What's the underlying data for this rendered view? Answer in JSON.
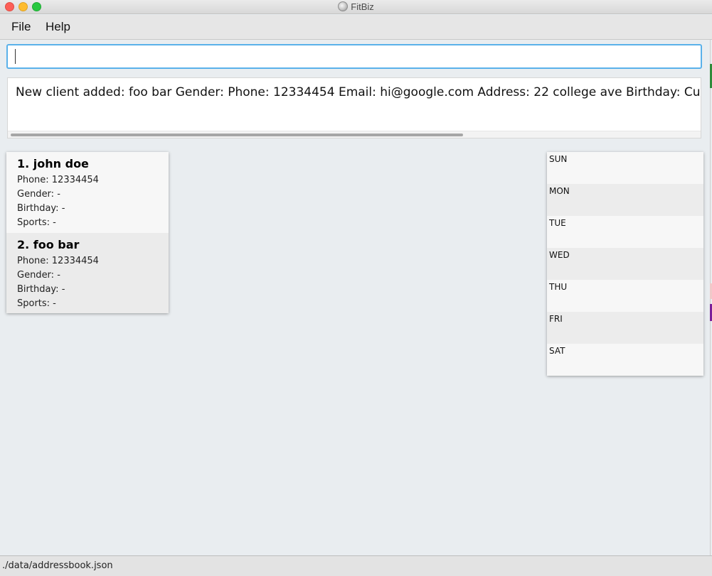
{
  "window": {
    "title": "FitBiz"
  },
  "menu": {
    "file_label": "File",
    "help_label": "Help"
  },
  "command": {
    "value": ""
  },
  "result": {
    "text": "New client added: foo bar Gender:  Phone: 12334454 Email: hi@google.com Address: 22 college ave Birthday:  Current W"
  },
  "clients": [
    {
      "name": "1.  john doe",
      "phone": "Phone: 12334454",
      "gender": "Gender: -",
      "birthday": "Birthday: -",
      "sports": "Sports: -"
    },
    {
      "name": "2.  foo bar",
      "phone": "Phone: 12334454",
      "gender": "Gender: -",
      "birthday": "Birthday: -",
      "sports": "Sports: -"
    }
  ],
  "schedule": {
    "days": [
      "SUN",
      "MON",
      "TUE",
      "WED",
      "THU",
      "FRI",
      "SAT"
    ]
  },
  "status": {
    "file_path": "./data/addressbook.json"
  },
  "colors": {
    "accent": "#5ab1ea",
    "background": "#e9edf0"
  }
}
